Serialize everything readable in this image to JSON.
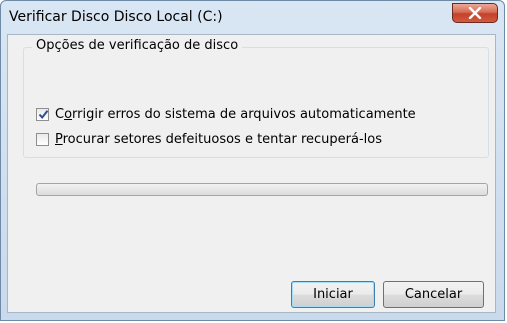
{
  "window": {
    "title": "Verificar Disco Disco Local (C:)"
  },
  "group": {
    "legend": "Opções de verificação de disco"
  },
  "options": [
    {
      "prefix": "C",
      "accel": "o",
      "rest": "rrigir erros do sistema de arquivos automaticamente",
      "checked": true
    },
    {
      "prefix": "",
      "accel": "P",
      "rest": "rocurar setores defeituosos e tentar recuperá-los",
      "checked": false
    }
  ],
  "progress": {
    "value": 0
  },
  "buttons": {
    "start": "Iniciar",
    "cancel": "Cancelar"
  }
}
